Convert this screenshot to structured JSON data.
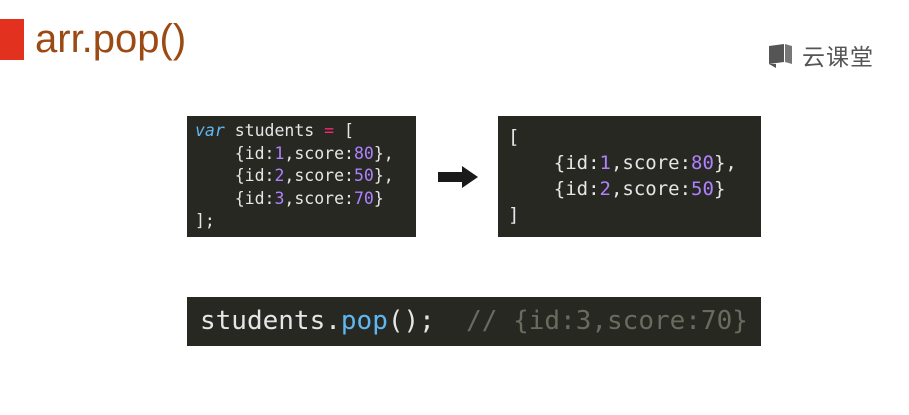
{
  "slide": {
    "title": "arr.pop()",
    "accent_color": "#e3311f",
    "logo": {
      "icon": "cloud-classroom-logo-icon",
      "text": "云课堂"
    }
  },
  "before_code": {
    "keyword": "var",
    "varname": " students ",
    "assign": "=",
    "open": " [",
    "items": [
      {
        "prefix": "    {id:",
        "id": "1",
        "mid": ",score:",
        "score": "80",
        "suffix": "},"
      },
      {
        "prefix": "    {id:",
        "id": "2",
        "mid": ",score:",
        "score": "50",
        "suffix": "},"
      },
      {
        "prefix": "    {id:",
        "id": "3",
        "mid": ",score:",
        "score": "70",
        "suffix": "}"
      }
    ],
    "close": "];"
  },
  "arrow": {
    "icon": "right-arrow-icon"
  },
  "after_code": {
    "open": "[",
    "items": [
      {
        "prefix": "    {id:",
        "id": "1",
        "mid": ",score:",
        "score": "80",
        "suffix": "},"
      },
      {
        "prefix": "    {id:",
        "id": "2",
        "mid": ",score:",
        "score": "50",
        "suffix": "}"
      }
    ],
    "close": "]"
  },
  "call_code": {
    "object": "students.",
    "method": "pop",
    "tail": "();",
    "comment": "  // {id:3,score:70}"
  }
}
